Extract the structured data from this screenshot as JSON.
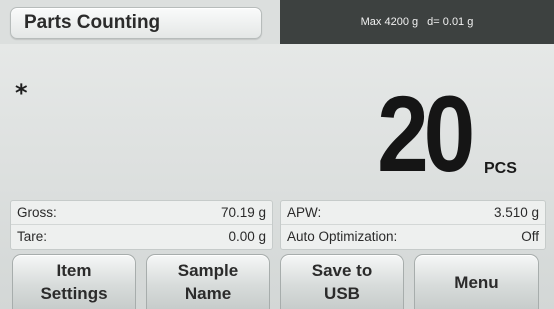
{
  "header": {
    "title": "Parts Counting",
    "capacity": "Max 4200 g",
    "readability": "d= 0.01 g"
  },
  "display": {
    "stability_indicator": "*",
    "value": "20",
    "unit": "PCS"
  },
  "info_left": {
    "row1": {
      "label": "Gross:",
      "value": "70.19 g"
    },
    "row2": {
      "label": "Tare:",
      "value": "0.00 g"
    }
  },
  "info_right": {
    "row1": {
      "label": "APW:",
      "value": "3.510 g"
    },
    "row2": {
      "label": "Auto Optimization:",
      "value": "Off"
    }
  },
  "softkeys": {
    "item_settings": {
      "line1": "Item",
      "line2": "Settings"
    },
    "sample_name": {
      "line1": "Sample",
      "line2": "Name"
    },
    "save_to_usb": {
      "line1": "Save to",
      "line2": "USB"
    },
    "menu": {
      "line1": "Menu"
    }
  },
  "colors": {
    "header_dark": "#3d4140",
    "background": "#dfe2e1",
    "text": "#151515"
  }
}
